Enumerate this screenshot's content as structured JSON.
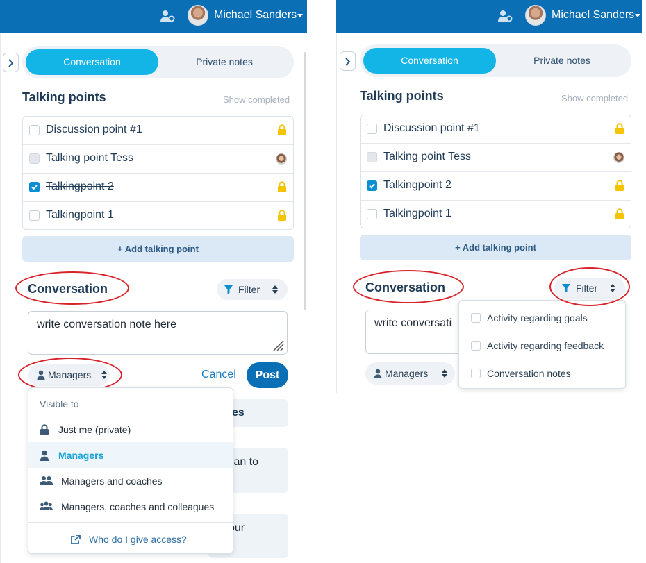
{
  "header": {
    "user_name": "Michael Sanders",
    "icons": [
      "user-settings-icon",
      "avatar",
      "caret-down-icon"
    ],
    "background_color": "#0a6fb5"
  },
  "tabs": {
    "conversation": "Conversation",
    "private_notes": "Private notes"
  },
  "talking_points": {
    "title": "Talking points",
    "show_completed": "Show completed",
    "items": [
      {
        "label": "Discussion point #1",
        "checked": false,
        "marker": "lock-icon"
      },
      {
        "label": "Talking point Tess",
        "checked": false,
        "marker": "avatar"
      },
      {
        "label": "Talkingpoint 2",
        "checked": true,
        "marker": "lock-icon"
      },
      {
        "label": "Talkingpoint 1",
        "checked": false,
        "marker": "lock-icon"
      }
    ],
    "add_button": "+ Add talking point"
  },
  "conversation": {
    "title": "Conversation",
    "filter_label": "Filter",
    "note_value": "write conversation note here",
    "note_value_truncated": "write conversati",
    "visibility_label": "Managers",
    "cancel_label": "Cancel",
    "post_label": "Post"
  },
  "visibility_dropdown": {
    "header": "Visible to",
    "options": [
      {
        "label": "Just me (private)",
        "icon": "lock-icon",
        "selected": false
      },
      {
        "label": "Managers",
        "icon": "person-icon",
        "selected": true
      },
      {
        "label": "Managers and coaches",
        "icon": "two-people-icon",
        "selected": false
      },
      {
        "label": "Managers, coaches and colleagues",
        "icon": "group-icon",
        "selected": false
      }
    ],
    "footer_link": "Who do I give access?"
  },
  "background_fragments": [
    "es",
    "l plan to",
    "our"
  ],
  "filter_dropdown": {
    "options": [
      {
        "label": "Activity regarding goals",
        "checked": false
      },
      {
        "label": "Activity regarding feedback",
        "checked": false
      },
      {
        "label": "Conversation notes",
        "checked": false
      }
    ]
  },
  "colors": {
    "accent": "#12b5e5",
    "primary": "#0a6fb5",
    "lock": "#f5c400",
    "annotation": "#d8232a"
  }
}
